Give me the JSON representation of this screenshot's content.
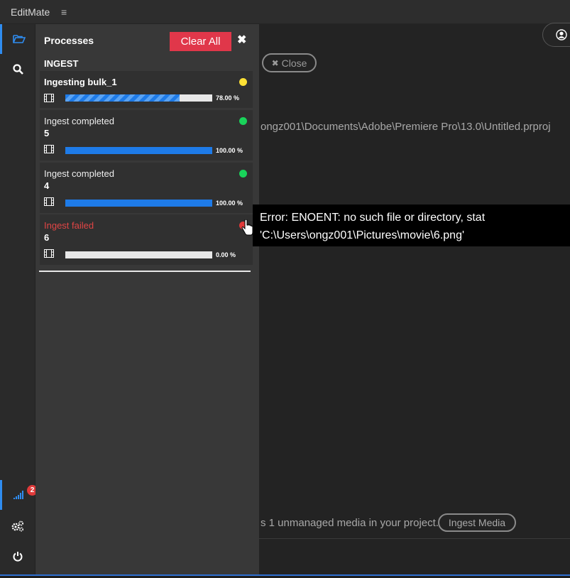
{
  "app": {
    "title": "EditMate",
    "menu_icon": "hamburger-menu-icon"
  },
  "sidebar": {
    "items": [
      {
        "icon": "folder-open-icon",
        "active": true
      },
      {
        "icon": "search-icon",
        "active": false
      },
      {
        "icon": "signal-bars-icon",
        "active": true,
        "badge": "2"
      },
      {
        "icon": "gears-icon",
        "active": false
      },
      {
        "icon": "power-icon",
        "active": false
      }
    ]
  },
  "main": {
    "close_label": "Close",
    "project_path": "ongz001\\Documents\\Adobe\\Premiere Pro\\13.0\\Untitled.prproj",
    "unmanaged_text": "s 1 unmanaged media in your project.",
    "ingest_media_label": "Ingest Media"
  },
  "panel": {
    "title": "Processes",
    "clear_all_label": "Clear All",
    "close_glyph": "✖",
    "section": "INGEST",
    "processes": [
      {
        "title": "Ingesting bulk_1",
        "number": "",
        "status_color": "#ffe135",
        "progress": 0.78,
        "percent_label": "78.00 %",
        "state": "running"
      },
      {
        "title": "Ingest completed",
        "number": "5",
        "status_color": "#19d35a",
        "progress": 1.0,
        "percent_label": "100.00 %",
        "state": "completed"
      },
      {
        "title": "Ingest completed",
        "number": "4",
        "status_color": "#19d35a",
        "progress": 1.0,
        "percent_label": "100.00 %",
        "state": "completed"
      },
      {
        "title": "Ingest failed",
        "number": "6",
        "status_color": "#e23a3a",
        "progress": 0.0,
        "percent_label": "0.00 %",
        "state": "failed"
      }
    ]
  },
  "tooltip": {
    "line1": "Error: ENOENT: no such file or directory, stat",
    "line2": "'C:\\Users\\ongz001\\Pictures\\movie\\6.png'"
  },
  "colors": {
    "accent": "#2f8cf0",
    "danger": "#e0374a",
    "progress": "#1e7be8"
  }
}
